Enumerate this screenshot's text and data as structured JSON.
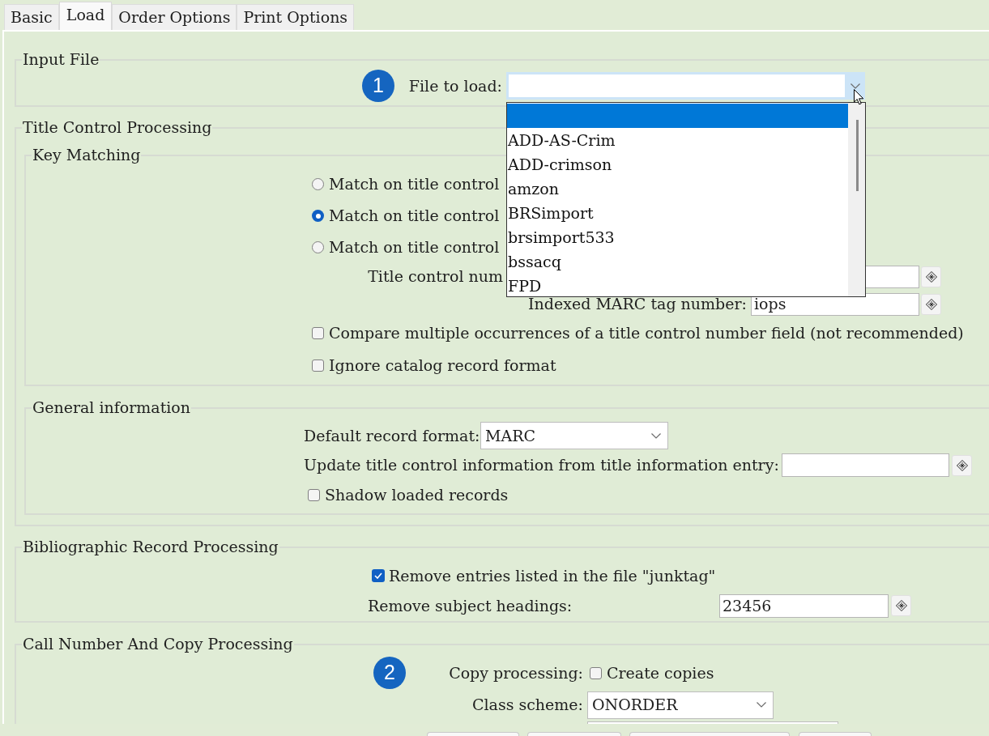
{
  "tabs": [
    {
      "label": "Basic",
      "selected": false
    },
    {
      "label": "Load",
      "selected": true
    },
    {
      "label": "Order Options",
      "selected": false
    },
    {
      "label": "Print Options",
      "selected": false
    }
  ],
  "input_file": {
    "legend": "Input File",
    "badge": "1",
    "file_to_load": {
      "label": "File to load:",
      "expanded": true,
      "options": [
        {
          "selected": true
        },
        {
          "label": "ADD-AS-Crim",
          "selected": false
        },
        {
          "label": "ADD-crimson",
          "selected": false
        },
        {
          "label": "amzon",
          "selected": false
        },
        {
          "label": "BRSimport",
          "selected": false
        },
        {
          "label": "brsimport533",
          "selected": false
        },
        {
          "label": "bssacq",
          "selected": false
        },
        {
          "label": "FPD",
          "selected": false
        }
      ]
    }
  },
  "title_control_processing": {
    "legend": "Title Control Processing",
    "key_matching": {
      "legend": "Key Matching",
      "match_options": [
        {
          "label": "Match on title control",
          "selected": false
        },
        {
          "label": "Match on title control",
          "selected": true
        },
        {
          "label": "Match on title control",
          "selected": false
        }
      ],
      "title_control_number": {
        "label": "Title control num"
      },
      "indexed_marc_tag_number": {
        "label": "Indexed MARC tag number:",
        "value": "iops"
      },
      "options": [
        {
          "label": "Compare multiple occurrences of a title control number field (not recommended)",
          "checked": false
        },
        {
          "label": "Ignore catalog record format",
          "checked": false
        }
      ]
    },
    "general_information": {
      "legend": "General information",
      "default_record_format": {
        "label": "Default record format:",
        "value": "MARC"
      },
      "update_title_control": {
        "label": "Update title control information from title information entry:"
      },
      "shadow_loaded_records": {
        "label": "Shadow loaded records",
        "checked": false
      }
    }
  },
  "bibliographic_record_processing": {
    "legend": "Bibliographic Record Processing",
    "remove_junktag": {
      "label": "Remove entries listed in the file \"junktag\"",
      "checked": true
    },
    "remove_subject_headings": {
      "label": "Remove subject headings:",
      "value": "23456"
    }
  },
  "call_number_and_copy_processing": {
    "legend": "Call Number And Copy Processing",
    "badge": "2",
    "copy_processing": {
      "label": "Copy processing:",
      "option_label": "Create copies",
      "checked": false
    },
    "class_scheme": {
      "label": "Class scheme:",
      "value": "ONORDER"
    }
  }
}
